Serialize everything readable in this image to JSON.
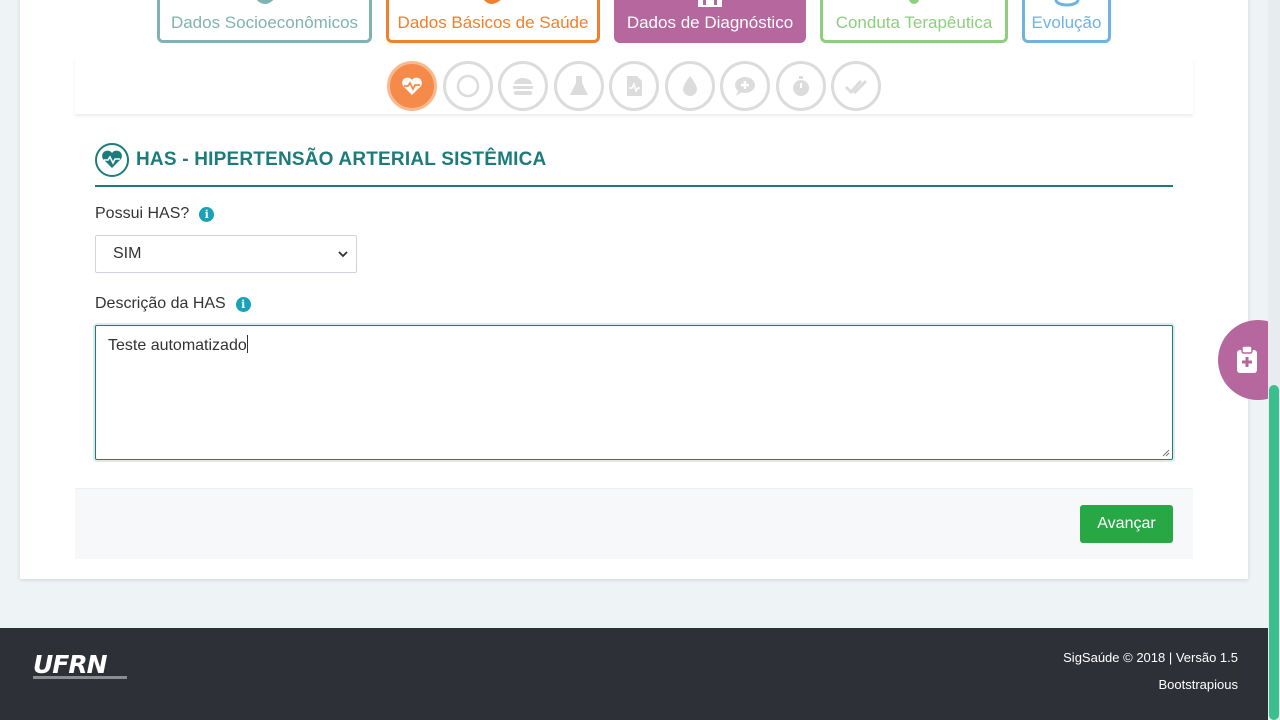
{
  "tabs": [
    {
      "label": "Dados Socioeconômicos"
    },
    {
      "label": "Dados Básicos de Saúde"
    },
    {
      "label": "Dados de Diagnóstico"
    },
    {
      "label": "Conduta Terapêutica"
    },
    {
      "label": "Evolução"
    }
  ],
  "steps": [
    {
      "icon": "heartbeat-icon",
      "active": true
    },
    {
      "icon": "circle-icon"
    },
    {
      "icon": "burger-icon"
    },
    {
      "icon": "flask-icon"
    },
    {
      "icon": "file-medical-icon"
    },
    {
      "icon": "drop-icon"
    },
    {
      "icon": "comment-medical-icon"
    },
    {
      "icon": "stopwatch-icon"
    },
    {
      "icon": "double-check-icon"
    }
  ],
  "section": {
    "title": "HAS - HIPERTENSÃO ARTERIAL SISTÊMICA"
  },
  "form": {
    "has_label": "Possui HAS?",
    "has_value": "SIM",
    "desc_label": "Descrição da HAS",
    "desc_value": "Teste automatizado",
    "next_label": "Avançar"
  },
  "footer": {
    "logo_text": "UFRN",
    "copyright": "SigSaúde © 2018 | Versão 1.5",
    "credit": "Bootstrapious"
  },
  "colors": {
    "teal": "#1e7b7b",
    "orange": "#f58a4b",
    "purple": "#b5679e",
    "green": "#28a745"
  }
}
